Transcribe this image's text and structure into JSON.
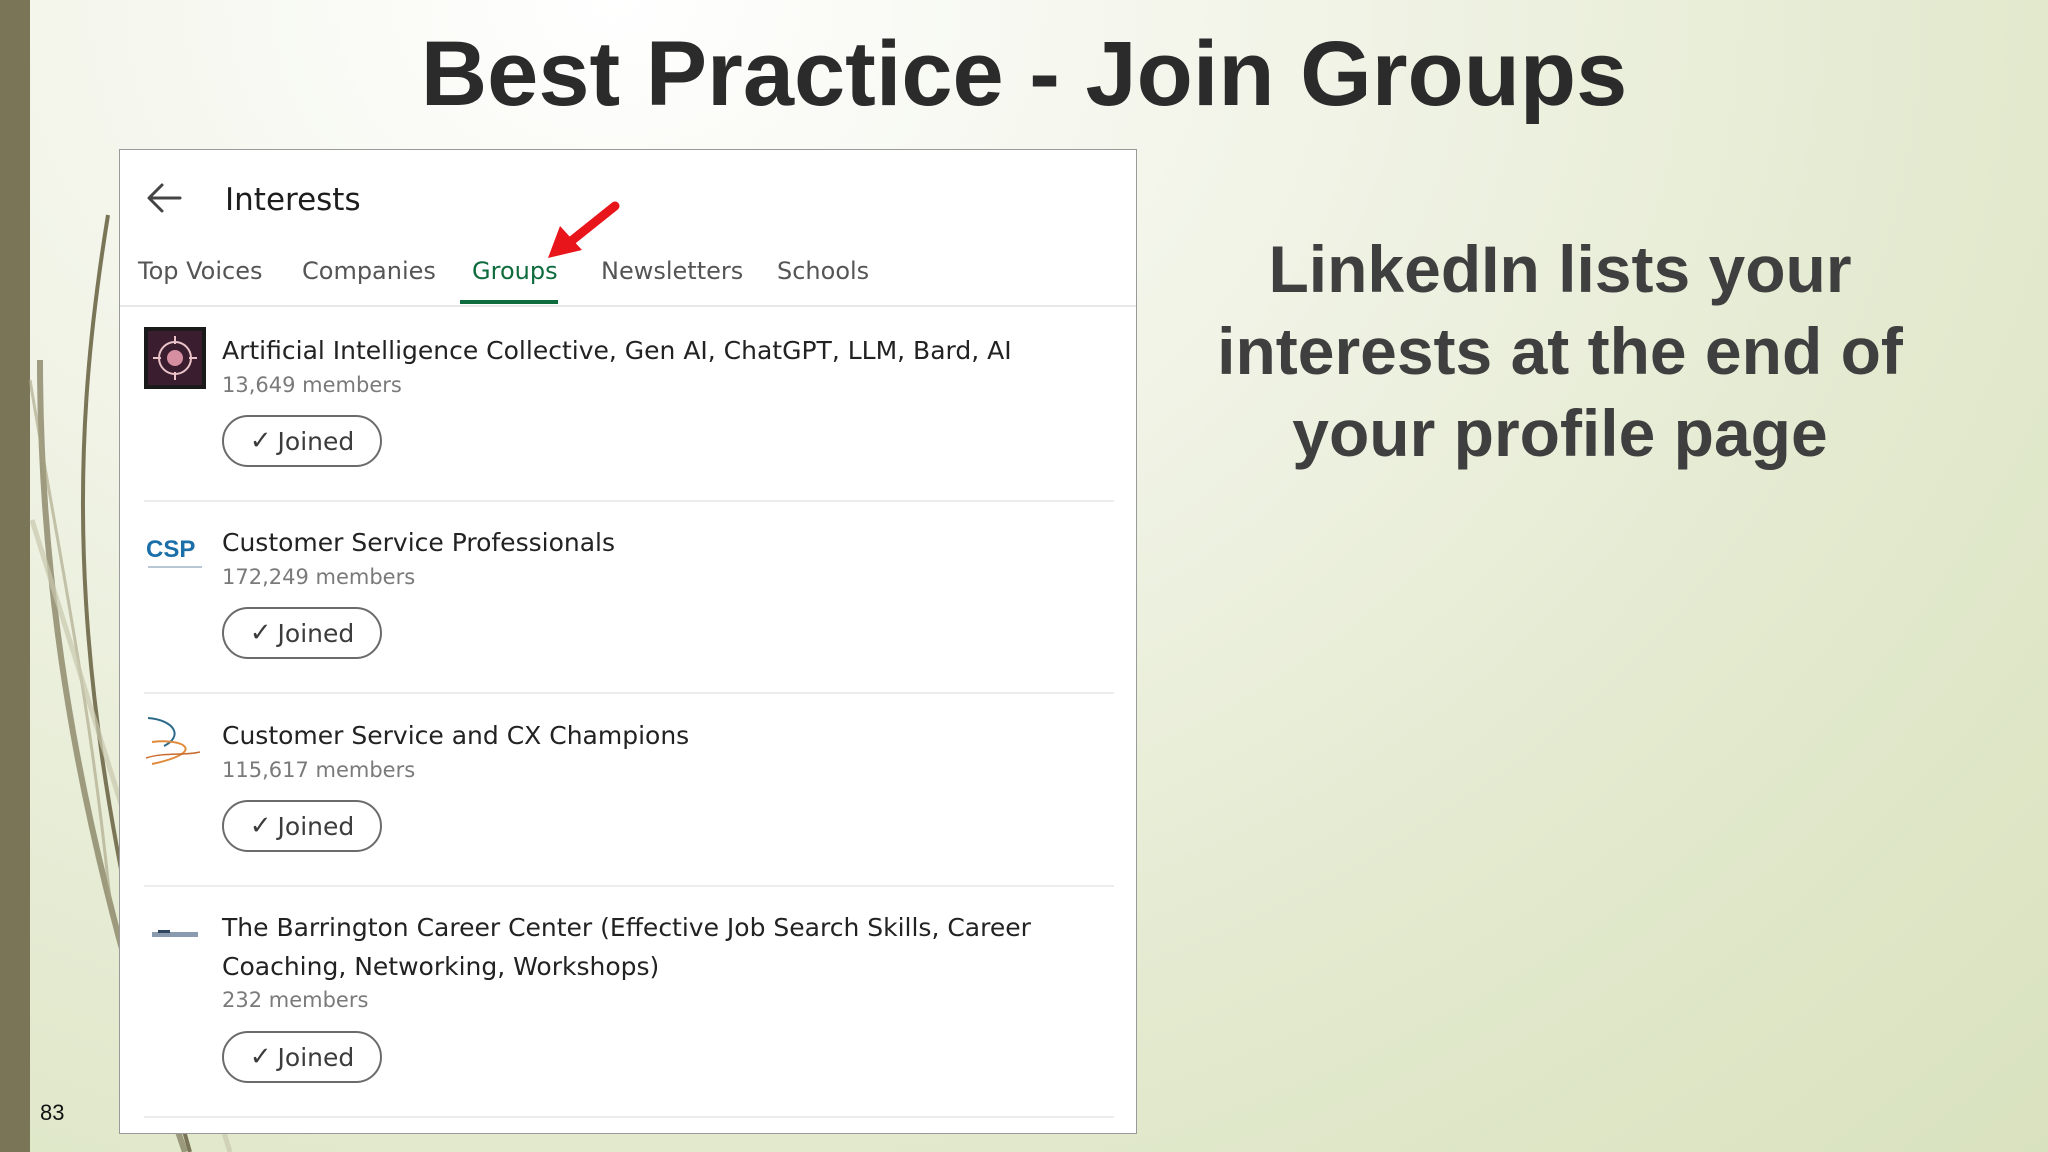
{
  "slide": {
    "title": "Best Practice - Join Groups",
    "side_text": "LinkedIn lists your interests at the end of your profile page",
    "page_number": "83"
  },
  "panel": {
    "title": "Interests",
    "tabs": [
      {
        "label": "Top Voices",
        "active": false
      },
      {
        "label": "Companies",
        "active": false
      },
      {
        "label": "Groups",
        "active": true
      },
      {
        "label": "Newsletters",
        "active": false
      },
      {
        "label": "Schools",
        "active": false
      }
    ],
    "groups": [
      {
        "name": "Artificial Intelligence Collective, Gen AI, ChatGPT, LLM, Bard, AI",
        "members": "13,649 members",
        "button": "Joined",
        "check_icon": "checkmark-icon"
      },
      {
        "name": "Customer Service Professionals",
        "members": "172,249 members",
        "button": "Joined",
        "check_icon": "checkmark-icon",
        "logo_text": "CSP"
      },
      {
        "name": "Customer Service and CX Champions",
        "members": "115,617 members",
        "button": "Joined",
        "check_icon": "checkmark-icon"
      },
      {
        "name": "The Barrington Career Center (Effective Job Search Skills, Career Coaching, Networking, Workshops)",
        "members": "232 members",
        "button": "Joined",
        "check_icon": "checkmark-icon"
      }
    ]
  },
  "colors": {
    "accent_tab": "#0e6b3d",
    "annotation_arrow": "#e8161b",
    "left_bar": "#7b7558"
  }
}
